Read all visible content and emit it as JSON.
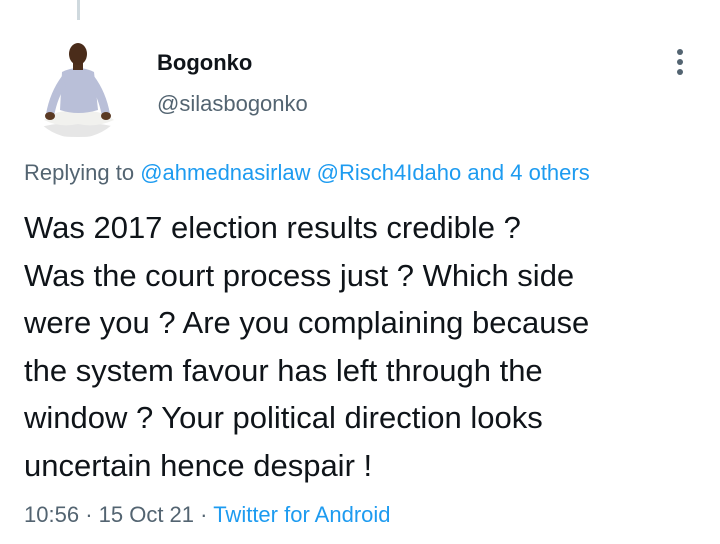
{
  "tweet": {
    "author": {
      "display_name": "Bogonko",
      "handle": "@silasbogonko"
    },
    "replying_label": "Replying to",
    "reply_to": [
      "@ahmednasirlaw",
      "@Risch4Idaho"
    ],
    "reply_others_connector": "and",
    "reply_others": "4 others",
    "text_lines": [
      "Was 2017 election results credible ?",
      "Was the court process just ? Which side",
      "were you ? Are you complaining because",
      "the system favour has left through the",
      "window ? Your political direction looks",
      "uncertain hence despair !"
    ],
    "time": "10:56",
    "separator": "·",
    "date": "15 Oct 21",
    "source": "Twitter for Android"
  },
  "icons": {
    "more": "more-vertical-icon",
    "avatar": "avatar-photo"
  },
  "colors": {
    "text": "#0f1419",
    "secondary": "#536471",
    "link": "#1d9bf0",
    "thread_line": "#cfd9de"
  }
}
